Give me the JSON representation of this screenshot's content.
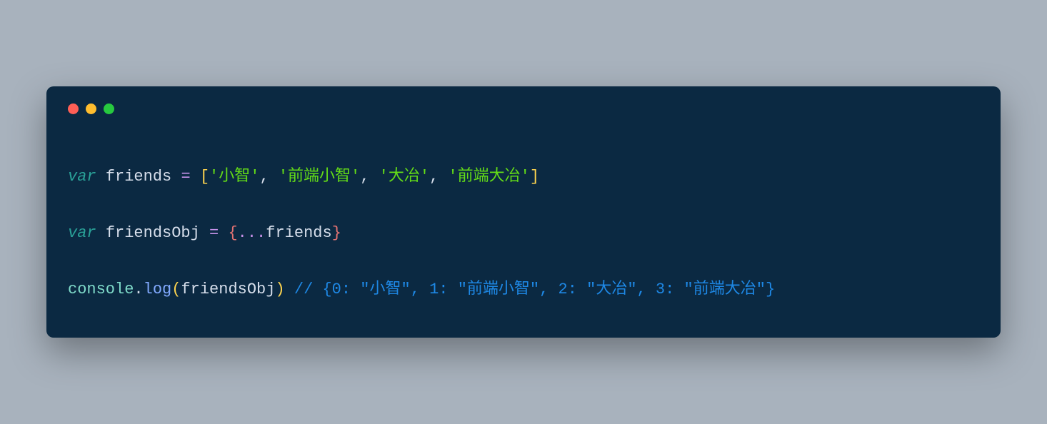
{
  "window": {
    "traffic": {
      "red": "#ff5f56",
      "yellow": "#ffbd2e",
      "green": "#27c93f"
    }
  },
  "code": {
    "line1": {
      "kw": "var",
      "ident": "friends",
      "eq": "=",
      "lb": "[",
      "s1": "'小智'",
      "c1": ",",
      "s2": "'前端小智'",
      "c2": ",",
      "s3": "'大冶'",
      "c3": ",",
      "s4": "'前端大冶'",
      "rb": "]"
    },
    "line2": {
      "kw": "var",
      "ident": "friendsObj",
      "eq": "=",
      "lb": "{",
      "spread": "...",
      "src": "friends",
      "rb": "}"
    },
    "line3": {
      "obj": "console",
      "dot": ".",
      "fn": "log",
      "lp": "(",
      "arg": "friendsObj",
      "rp": ")",
      "comment": "// {0: \"小智\", 1: \"前端小智\", 2: \"大冶\", 3: \"前端大冶\"}"
    }
  }
}
